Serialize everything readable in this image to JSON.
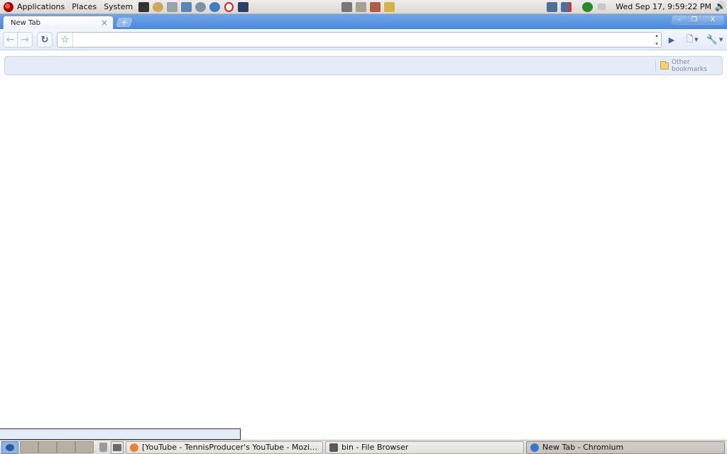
{
  "top_panel": {
    "menus": [
      "Applications",
      "Places",
      "System"
    ],
    "launchers": [
      "camera-icon",
      "cd-icon",
      "mail-icon",
      "image-viewer-icon",
      "network-icon",
      "globe-icon",
      "opera-icon",
      "terminal-icon"
    ],
    "center_launchers": [
      "printer-icon",
      "document-icon",
      "book-icon",
      "keys-icon"
    ],
    "tray": [
      "network-status-icon",
      "network-disconnected-icon",
      "update-icon",
      "keyboard-icon"
    ],
    "clock": "Wed Sep 17,  9:59:22 PM"
  },
  "browser": {
    "tab": {
      "title": "New Tab",
      "close": "×"
    },
    "new_tab": "+",
    "window_buttons": {
      "minimize": "–",
      "maximize": "❐",
      "close": "X"
    },
    "omnibox": {
      "value": "",
      "placeholder": ""
    },
    "bookmarks": {
      "other_label": "Other bookmarks"
    }
  },
  "taskbar": {
    "tasks": [
      {
        "label": "[YouTube - TennisProducer's YouTube - Mozilla Fi...",
        "active": false
      },
      {
        "label": "bin - File Browser",
        "active": false
      },
      {
        "label": "New Tab - Chromium",
        "active": true
      }
    ]
  },
  "colors": {
    "tabstrip": "#4c86d6",
    "toolbar": "#e4ecf7",
    "bookmark_bar": "#e4ecf8"
  }
}
